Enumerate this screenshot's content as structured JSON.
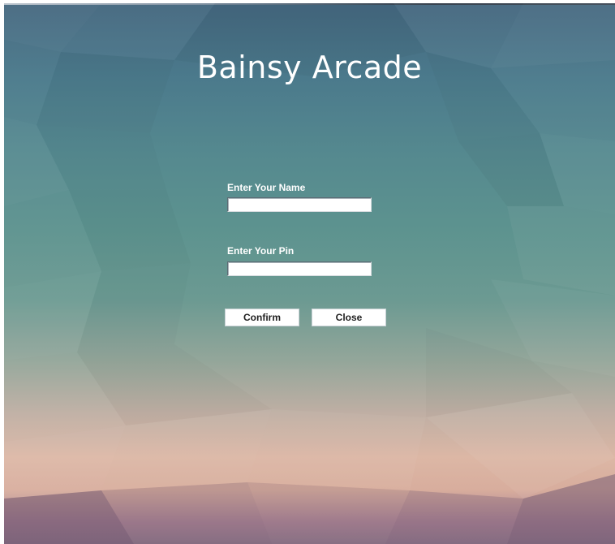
{
  "app": {
    "title": "Bainsy Arcade"
  },
  "form": {
    "name_label": "Enter Your Name",
    "name_value": "",
    "pin_label": "Enter Your Pin",
    "pin_value": ""
  },
  "buttons": {
    "confirm_label": "Confirm",
    "close_label": "Close"
  },
  "colors": {
    "background_top": "#44677f",
    "background_middle": "#5d938f",
    "background_bottom": "#dcb7a5",
    "text": "#ffffff"
  }
}
